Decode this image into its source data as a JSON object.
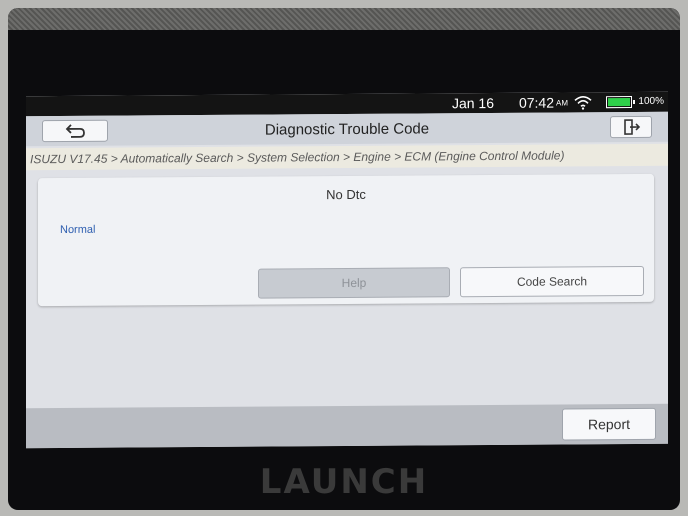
{
  "status_bar": {
    "date": "Jan 16",
    "time": "07:42",
    "ampm": "AM",
    "wifi_icon": "wifi-icon",
    "battery_icon": "battery-icon",
    "battery": "100%"
  },
  "header": {
    "title": "Diagnostic Trouble Code",
    "back_icon": "back-arrow-icon",
    "exit_icon": "exit-icon"
  },
  "breadcrumb": "ISUZU V17.45 > Automatically Search > System Selection > Engine > ECM (Engine Control Module)",
  "panel": {
    "title": "No Dtc",
    "status": "Normal",
    "help_label": "Help",
    "code_search_label": "Code Search"
  },
  "footer": {
    "report_label": "Report"
  },
  "device": {
    "brand": "LAUNCH"
  },
  "colors": {
    "screen_bg": "#dfe1e6",
    "status_text": "#2f5fb0",
    "battery_fill": "#2fd04a"
  }
}
